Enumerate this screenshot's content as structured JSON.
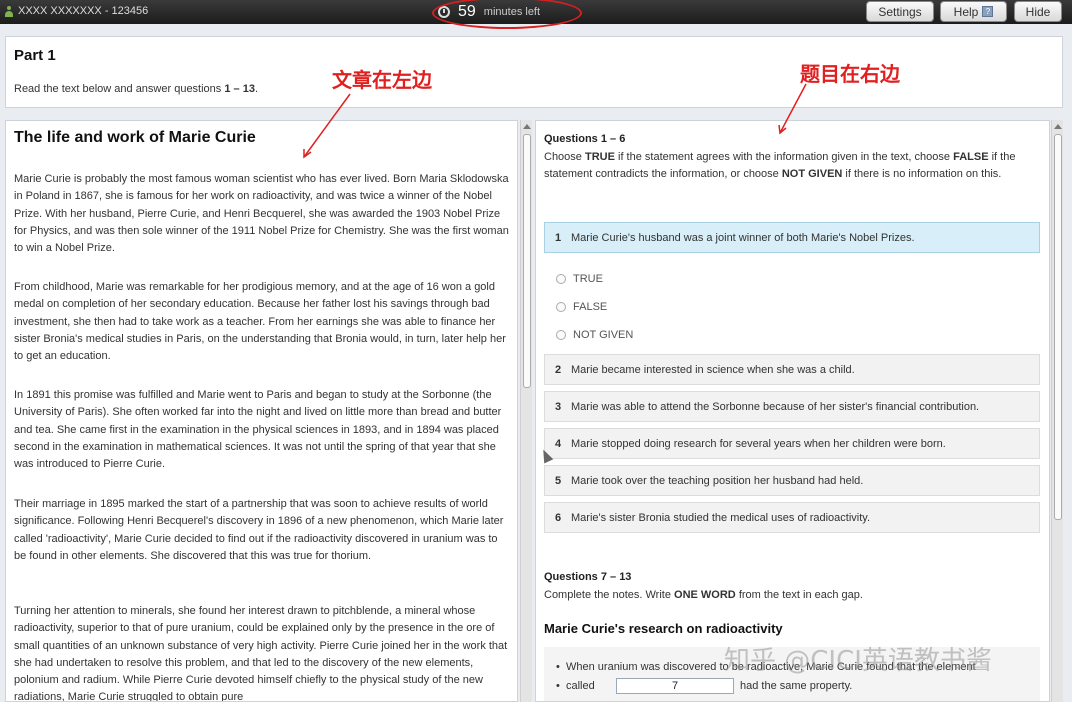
{
  "topbar": {
    "candidate": "XXXX XXXXXXX - 123456",
    "timer_number": "59",
    "timer_unit": "minutes left",
    "settings_label": "Settings",
    "help_label": "Help",
    "hide_label": "Hide"
  },
  "part": {
    "title": "Part 1",
    "instruction_prefix": "Read the text below and answer questions ",
    "instruction_range": "1 – 13",
    "instruction_suffix": "."
  },
  "annotations": {
    "left": "文章在左边",
    "right": "题目在右边",
    "color": "#e02020"
  },
  "passage": {
    "title": "The life and work of Marie Curie",
    "paragraphs": [
      "Marie Curie is probably the most famous woman scientist who has ever lived. Born Maria Sklodowska in Poland in 1867, she is famous for her work on radioactivity, and was twice a winner of the Nobel Prize. With her husband, Pierre Curie, and Henri Becquerel, she was awarded the 1903 Nobel Prize for Physics, and was then sole winner of the 1911 Nobel Prize for Chemistry. She was the first woman to win a Nobel Prize.",
      "From childhood, Marie was remarkable for her prodigious memory, and at the age of 16 won a gold medal on completion of her secondary education. Because her father lost his savings through bad investment, she then had to take work as a teacher. From her earnings she was able to finance her sister Bronia's medical studies in Paris, on the understanding that Bronia would, in turn, later help her to get an education.",
      "In 1891 this promise was fulfilled and Marie went to Paris and began to study at the Sorbonne (the University of Paris). She often worked far into the night and lived on little more than bread and butter and tea. She came first in the examination in the physical sciences in 1893, and in 1894 was placed second in the examination in mathematical sciences. It was not until the spring of that year that she was introduced to Pierre Curie.",
      "Their marriage in 1895 marked the start of a partnership that was soon to achieve results of world significance. Following Henri Becquerel's discovery in 1896 of a new phenomenon, which Marie later called 'radioactivity', Marie Curie decided to find out if the radioactivity discovered in uranium was to be found in other elements. She discovered that this was true for thorium.",
      "Turning her attention to minerals, she found her interest drawn to pitchblende, a mineral whose radioactivity, superior to that of pure uranium, could be explained only by the presence in the ore of small quantities of an unknown substance of very high activity. Pierre Curie joined her in the work that she had undertaken to resolve this problem, and that led to the discovery of the new elements, polonium and radium. While Pierre Curie devoted himself chiefly to the physical study of the new radiations, Marie Curie struggled to obtain pure"
    ]
  },
  "questions_1_6": {
    "heading": "Questions 1 – 6",
    "instr_1": "Choose ",
    "instr_true": "TRUE",
    "instr_2": " if the statement agrees with the information given in the text, choose ",
    "instr_false": "FALSE",
    "instr_3": " if the statement contradicts the information, or choose ",
    "instr_ng": "NOT GIVEN",
    "instr_4": " if there is no information on this.",
    "items": [
      {
        "num": "1",
        "text": "Marie Curie's husband was a joint winner of both Marie's Nobel Prizes."
      },
      {
        "num": "2",
        "text": "Marie became interested in science when she was a child."
      },
      {
        "num": "3",
        "text": "Marie was able to attend the Sorbonne because of her sister's financial contribution."
      },
      {
        "num": "4",
        "text": "Marie stopped doing research for several years when her children were born."
      },
      {
        "num": "5",
        "text": "Marie took over the teaching position her husband had held."
      },
      {
        "num": "6",
        "text": "Marie's sister Bronia studied the medical uses of radioactivity."
      }
    ],
    "options": [
      "TRUE",
      "FALSE",
      "NOT GIVEN"
    ]
  },
  "questions_7_13": {
    "heading": "Questions 7 – 13",
    "instr_1": "Complete the notes. Write ",
    "instr_bold": "ONE WORD",
    "instr_2": " from the text in each gap.",
    "notes_title": "Marie Curie's research on radioactivity",
    "bullet_line1": "When uranium was discovered to be radioactive, Marie Curie found that the element",
    "bullet_called": "called",
    "gap_value": "7",
    "bullet_after": "had the same property."
  },
  "watermark": "知乎 @CICI英语教书酱"
}
